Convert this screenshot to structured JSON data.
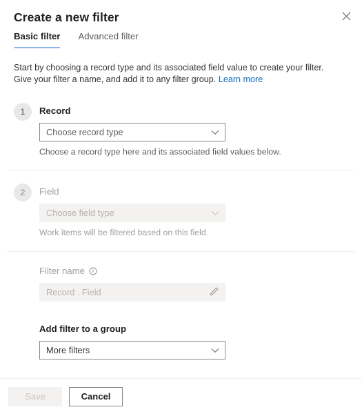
{
  "panel": {
    "title": "Create a new filter",
    "close_icon": "close-icon"
  },
  "tabs": [
    {
      "label": "Basic filter",
      "active": true
    },
    {
      "label": "Advanced filter",
      "active": false
    }
  ],
  "intro": {
    "text": "Start by choosing a record type and its associated field value to create your filter. Give your filter a name, and add it to any filter group.",
    "link_label": "Learn more"
  },
  "steps": [
    {
      "number": "1",
      "label": "Record",
      "dropdown_value": "Choose record type",
      "hint": "Choose a record type here and its associated field values below.",
      "disabled": false
    },
    {
      "number": "2",
      "label": "Field",
      "dropdown_value": "Choose field type",
      "hint": "Work items will be filtered based on this field.",
      "disabled": true
    }
  ],
  "filter_name": {
    "label": "Filter name",
    "info_icon": "info-icon",
    "value": "Record . Field",
    "edit_icon": "pencil-icon"
  },
  "group": {
    "label": "Add filter to a group",
    "dropdown_value": "More filters"
  },
  "footer": {
    "save_label": "Save",
    "cancel_label": "Cancel"
  },
  "colors": {
    "tab_accent": "#8cb4ec",
    "link": "#0f6cbd",
    "step_badge_bg": "#e8e8e8",
    "disabled_field_bg": "#f3f2f1",
    "border": "#8a8886"
  }
}
